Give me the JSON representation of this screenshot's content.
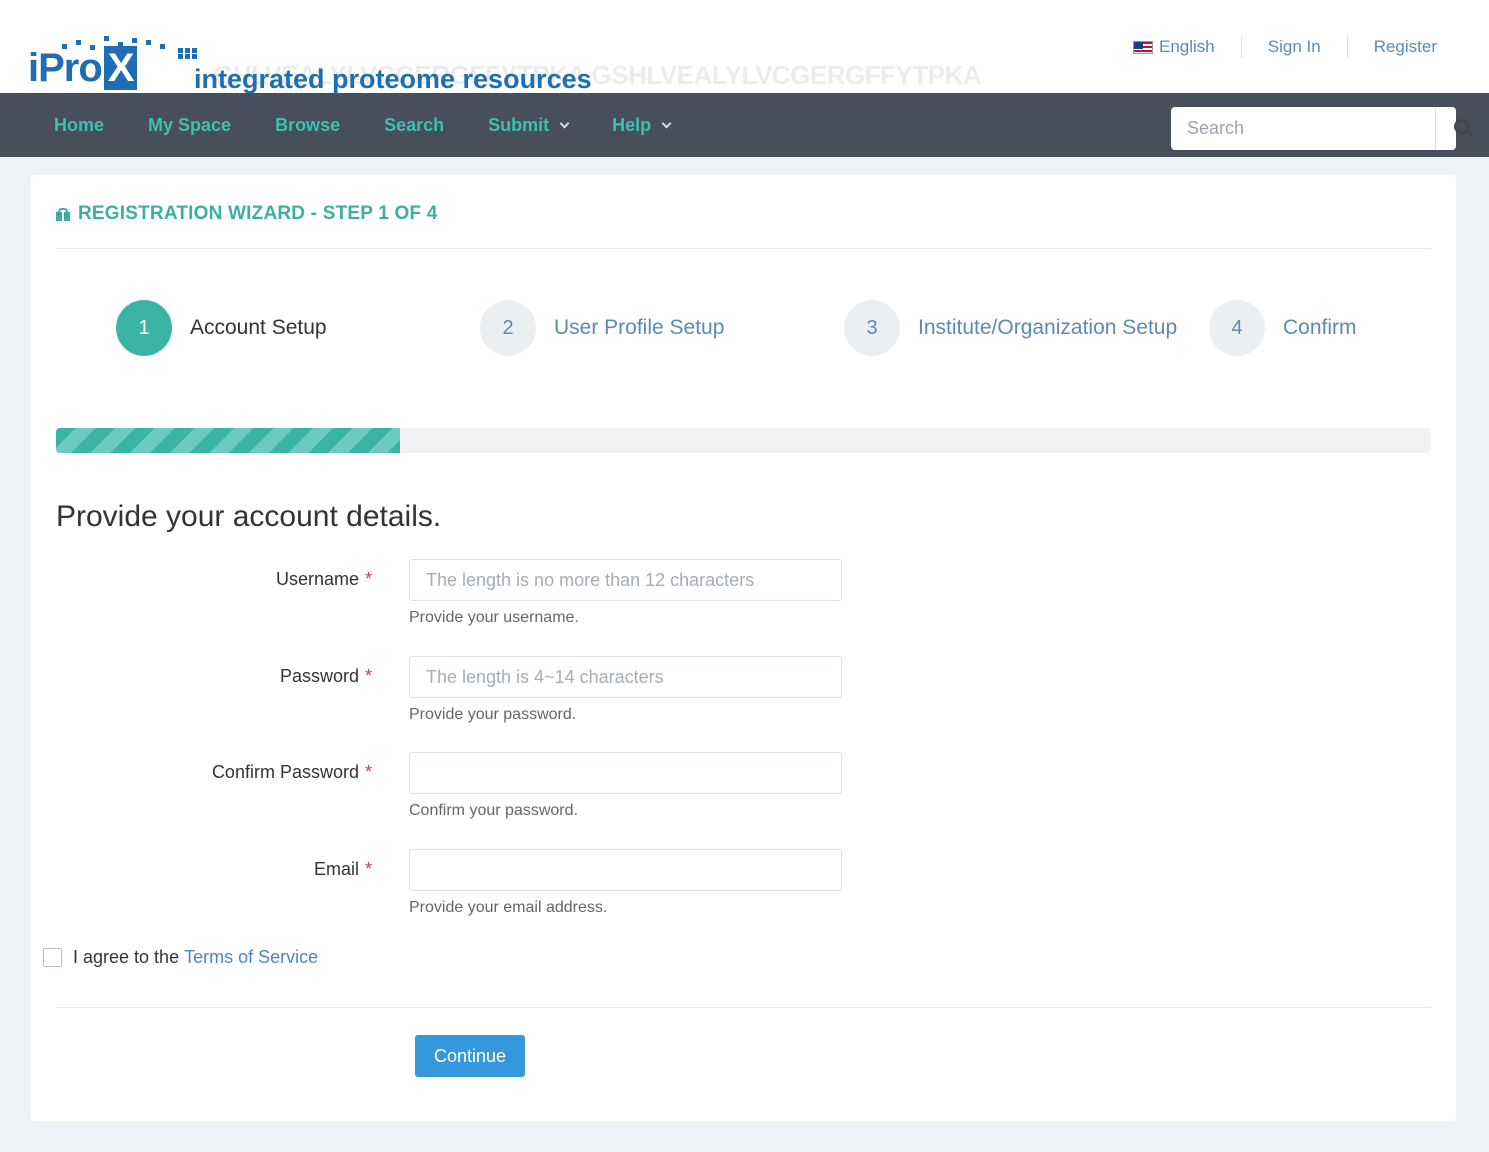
{
  "header": {
    "logo_mark": "iPro",
    "logo_x": "X",
    "logo_tagline": "integrated proteome resources",
    "logo_background_sequence": "GHLVEALYLVCGERGFFYTPKA GSHLVEALYLVCGERGFFYTPKA",
    "links": {
      "language": "English",
      "sign_in": "Sign In",
      "register": "Register"
    }
  },
  "nav": {
    "items": [
      "Home",
      "My Space",
      "Browse",
      "Search",
      "Submit",
      "Help"
    ],
    "search_placeholder": "Search"
  },
  "wizard": {
    "title": "REGISTRATION WIZARD - STEP 1 OF 4",
    "steps": [
      {
        "num": "1",
        "label": "Account Setup"
      },
      {
        "num": "2",
        "label": "User Profile Setup"
      },
      {
        "num": "3",
        "label": "Institute/Organization Setup"
      },
      {
        "num": "4",
        "label": "Confirm"
      }
    ],
    "active_step": 1,
    "progress_percent": 25
  },
  "form": {
    "heading": "Provide your account details.",
    "required_mark": "*",
    "fields": [
      {
        "label": "Username",
        "placeholder": "The length is no more than 12 characters",
        "help": "Provide your username."
      },
      {
        "label": "Password",
        "placeholder": "The length is 4~14 characters",
        "help": "Provide your password."
      },
      {
        "label": "Confirm Password",
        "placeholder": "",
        "help": "Confirm your password."
      },
      {
        "label": "Email",
        "placeholder": "",
        "help": "Provide your email address."
      }
    ],
    "agree_text": "I agree to the",
    "tos_link": "Terms of Service",
    "continue_label": "Continue"
  },
  "colors": {
    "nav_bg": "#474f5c",
    "nav_text": "#3cc0b0",
    "accent": "#3cb4a5",
    "brand_blue": "#1f6db5",
    "link": "#5b8bb5",
    "button": "#3598dc",
    "required": "#e0384a"
  },
  "icons": {
    "language": "us-flag-icon",
    "search": "search-icon",
    "title": "gift-icon",
    "dropdown": "chevron-down-icon"
  }
}
